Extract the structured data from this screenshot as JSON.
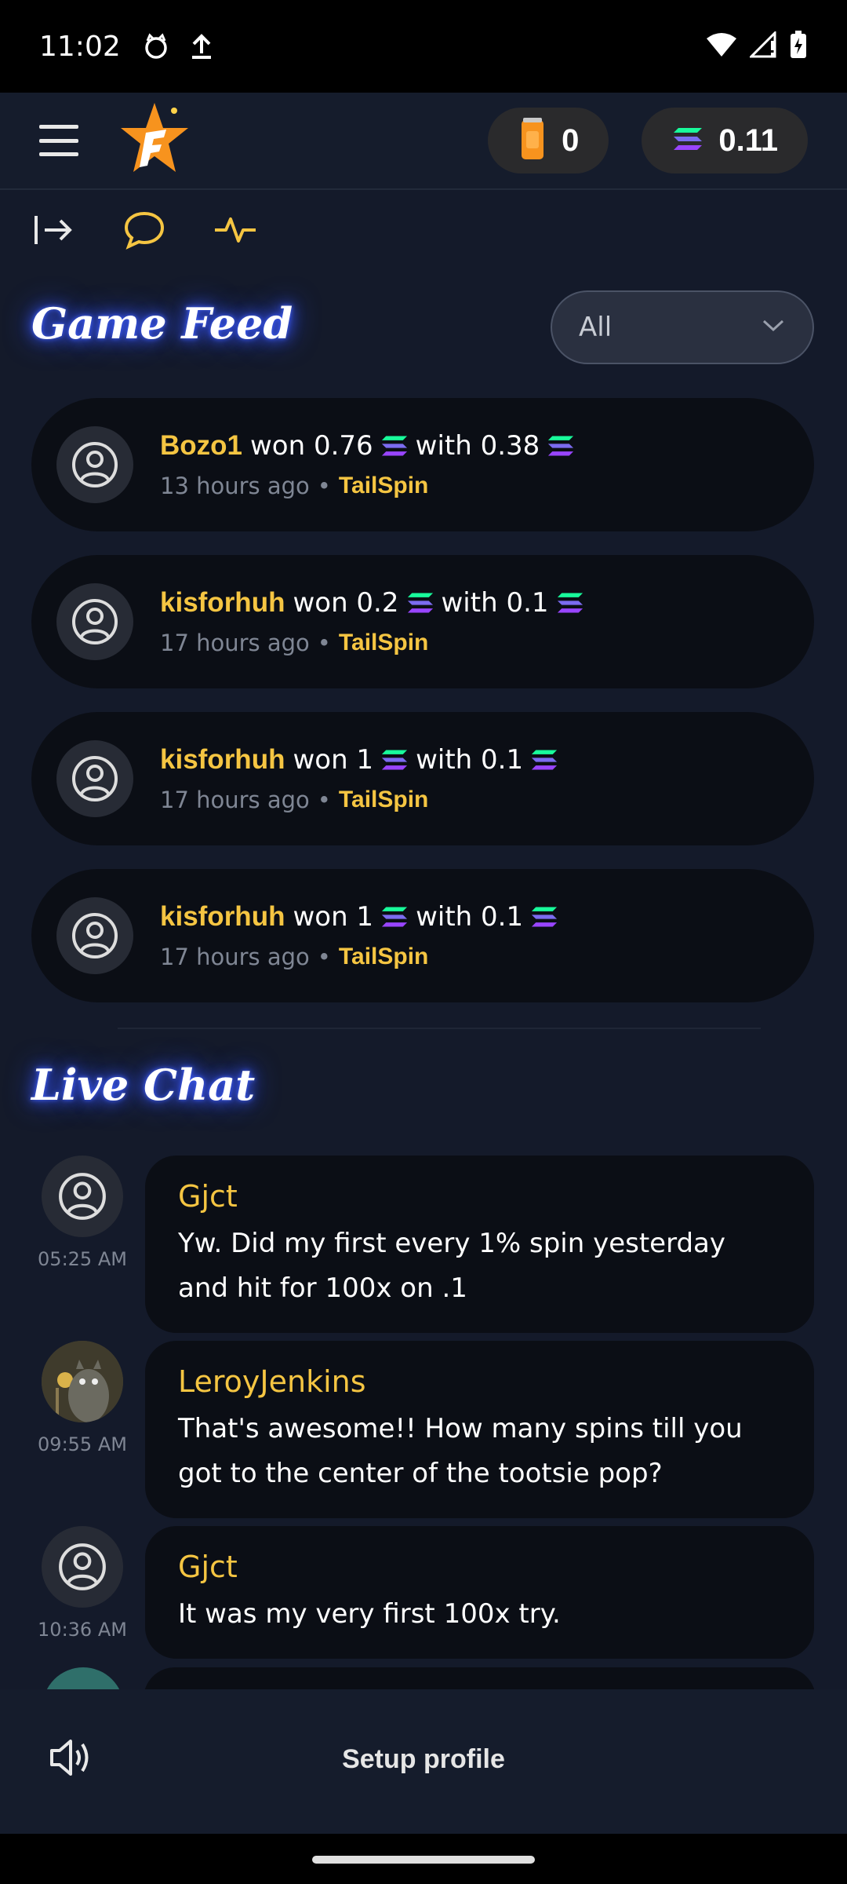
{
  "status_bar": {
    "time": "11:02"
  },
  "header": {
    "balances": [
      {
        "icon": "soda-can-icon",
        "value": "0"
      },
      {
        "icon": "solana-icon",
        "value": "0.11"
      }
    ]
  },
  "game_feed": {
    "title": "Game Feed",
    "filter": {
      "selected": "All"
    },
    "items": [
      {
        "user": "Bozo1",
        "won_text": "won 0.76",
        "with_text": "with 0.38",
        "time": "13 hours ago",
        "separator": "•",
        "game": "TailSpin"
      },
      {
        "user": "kisforhuh",
        "won_text": "won 0.2",
        "with_text": "with 0.1",
        "time": "17 hours ago",
        "separator": "•",
        "game": "TailSpin"
      },
      {
        "user": "kisforhuh",
        "won_text": "won 1",
        "with_text": "with 0.1",
        "time": "17 hours ago",
        "separator": "•",
        "game": "TailSpin"
      },
      {
        "user": "kisforhuh",
        "won_text": "won 1",
        "with_text": "with 0.1",
        "time": "17 hours ago",
        "separator": "•",
        "game": "TailSpin"
      }
    ]
  },
  "live_chat": {
    "title": "Live Chat",
    "messages": [
      {
        "user": "Gjct",
        "time": "05:25 AM",
        "text": "Yw. Did my first every 1% spin yesterday and hit for 100x on .1"
      },
      {
        "user": "LeroyJenkins",
        "time": "09:55 AM",
        "text": "That's awesome!! How many spins till you got to the center of the tootsie pop?"
      },
      {
        "user": "Gjct",
        "time": "10:36 AM",
        "text": "It was my very first 100x try."
      }
    ]
  },
  "bottom_bar": {
    "setup_profile_label": "Setup profile"
  },
  "colors": {
    "accent_yellow": "#f5c542",
    "background": "#141a2a",
    "card": "#0b0e15"
  }
}
